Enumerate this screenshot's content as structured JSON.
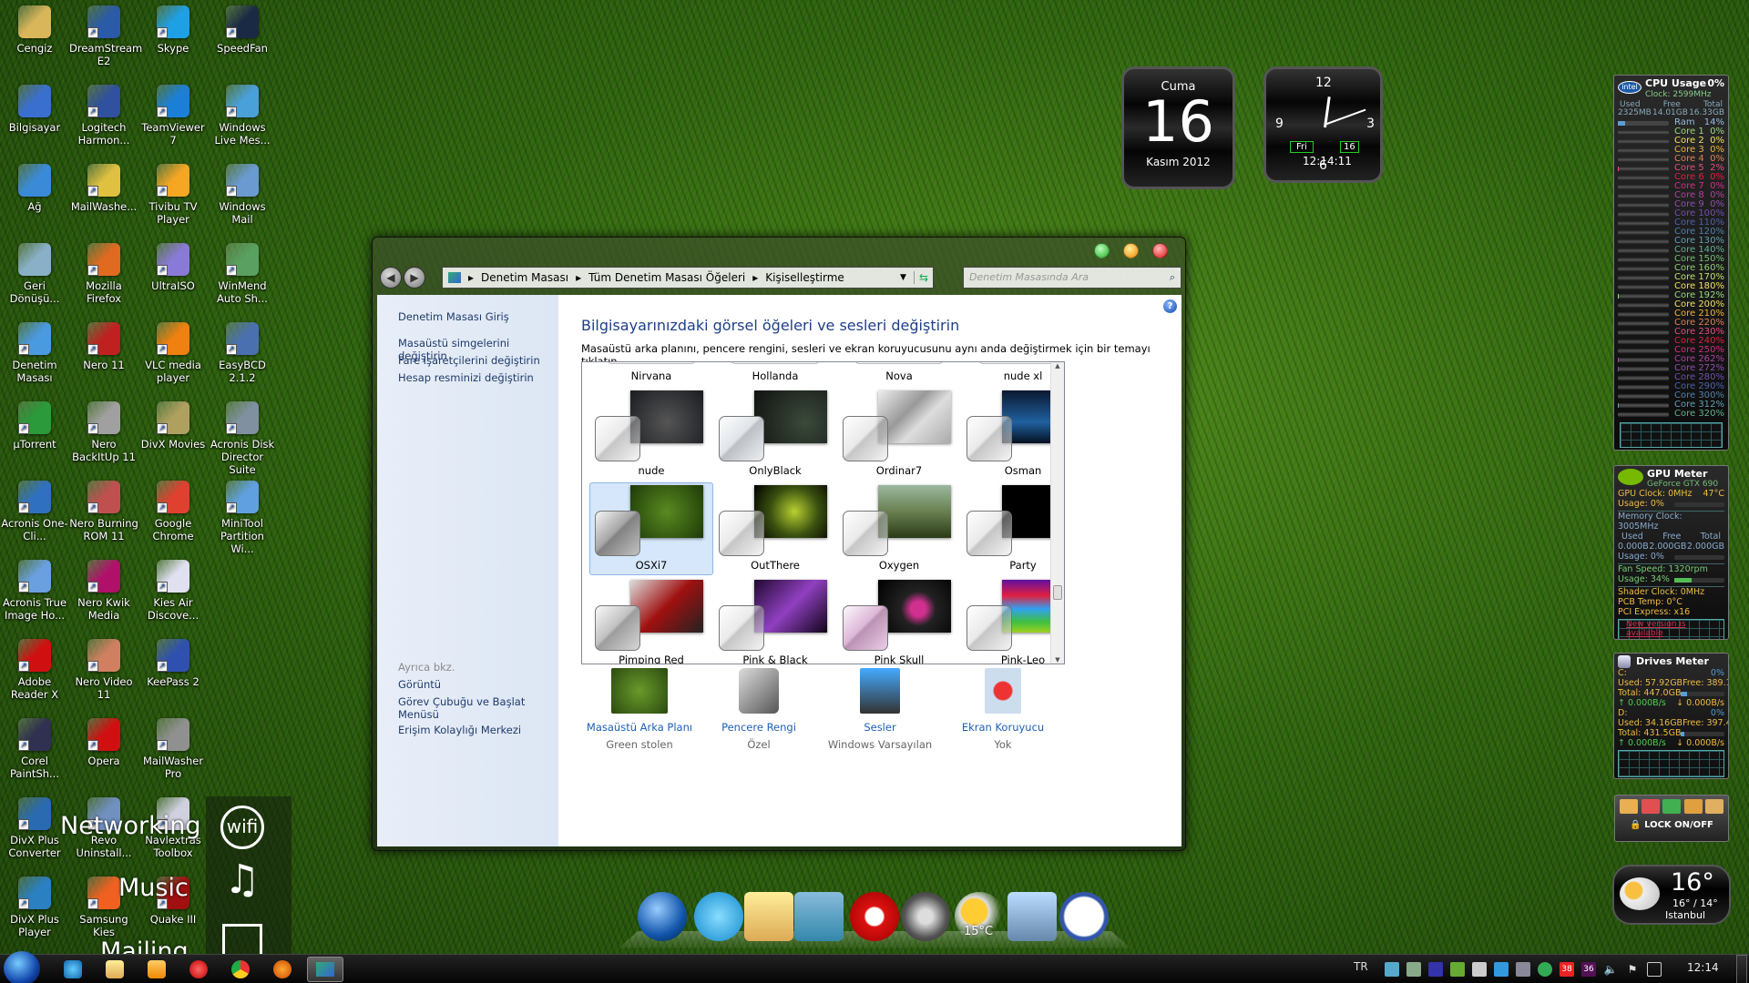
{
  "desktop_icons": [
    [
      "Cengiz",
      "DreamStream E2",
      "Skype",
      "SpeedFan"
    ],
    [
      "Bilgisayar",
      "Logitech Harmon...",
      "TeamViewer 7",
      "Windows Live Mes..."
    ],
    [
      "Ağ",
      "MailWashe...",
      "Tivibu TV Player",
      "Windows Mail"
    ],
    [
      "Geri Dönüşü...",
      "Mozilla Firefox",
      "UltraISO",
      "WinMend Auto Sh..."
    ],
    [
      "Denetim Masası",
      "Nero 11",
      "VLC media player",
      "EasyBCD 2.1.2"
    ],
    [
      "µTorrent",
      "Nero BackItUp 11",
      "DivX Movies",
      "Acronis Disk Director Suite"
    ],
    [
      "Acronis One-Cli...",
      "Nero Burning ROM 11",
      "Google Chrome",
      "MiniTool Partition Wi..."
    ],
    [
      "Acronis True Image Ho...",
      "Nero Kwik Media",
      "Kies Air Discove..."
    ],
    [
      "Adobe Reader X",
      "Nero Video 11",
      "KeePass 2"
    ],
    [
      "Corel PaintSh...",
      "Opera",
      "MailWasher Pro"
    ],
    [
      "DivX Plus Converter",
      "Revo Uninstall...",
      "Navlextras Toolbox"
    ],
    [
      "DivX Plus Player",
      "Samsung Kies",
      "Quake III"
    ]
  ],
  "desktop_icon_colors": [
    [
      "#d9b65a",
      "#2a5aa8",
      "#1ea0e6",
      "#1a2a44"
    ],
    [
      "#3a6fd0",
      "#3050a0",
      "#1b7fd8",
      "#4aa0d8"
    ],
    [
      "#3a8ad8",
      "#e0c040",
      "#f5a623",
      "#6a9ad0"
    ],
    [
      "#8ab0c8",
      "#e06a20",
      "#8a7ad8",
      "#5aa060"
    ],
    [
      "#4a9ae0",
      "#c02020",
      "#f08010",
      "#4a70b0"
    ],
    [
      "#2a9a3a",
      "#a0a0a0",
      "#b0a060",
      "#8090a0"
    ],
    [
      "#3070c0",
      "#c05050",
      "#e04030",
      "#60a0e0"
    ],
    [
      "#6aa0e0",
      "#b0106a",
      "#e0e0f0"
    ],
    [
      "#d01010",
      "#d08060",
      "#3050b0"
    ],
    [
      "#303050",
      "#d01010",
      "#909090"
    ],
    [
      "#2a6ab0",
      "#7090c0",
      "#d0d0e0"
    ],
    [
      "#2a80c0",
      "#f06020",
      "#a01010"
    ]
  ],
  "tiles": {
    "networking": "Networking",
    "wifi": "wifi",
    "music": "Music",
    "mailing": "Mailing"
  },
  "calendar": {
    "day_name": "Cuma",
    "day": "16",
    "month_year": "Kasım 2012"
  },
  "clock": {
    "n12": "12",
    "n3": "3",
    "n6": "6",
    "n9": "9",
    "weekday": "Fri",
    "date": "16",
    "time": "12:14:11"
  },
  "cpu": {
    "title": "CPU Usage",
    "total": "0%",
    "clock": "Clock: 2599MHz",
    "headers": [
      "Used",
      "Free",
      "Total"
    ],
    "mem": [
      "2325MB",
      "14.01GB",
      "16.33GB"
    ],
    "ram_label": "Ram",
    "ram_pct": 14,
    "ram": "14%",
    "cores": [
      0,
      0,
      0,
      0,
      2,
      0,
      0,
      0,
      0,
      0,
      0,
      0,
      0,
      0,
      0,
      0,
      0,
      0,
      2,
      0,
      0,
      0,
      0,
      0,
      0,
      2,
      2,
      0,
      0,
      0,
      2,
      0
    ],
    "core_prefix": "Core ",
    "core_colors": [
      "#9ad97a",
      "#f0e060",
      "#f0b040",
      "#e08050",
      "#e05080",
      "#e02040",
      "#d03080",
      "#b040a0",
      "#9050b0",
      "#7050b0",
      "#5060b0",
      "#5080b0",
      "#60a0b0",
      "#60b090",
      "#70c070",
      "#90d070",
      "#c0e070",
      "#f0e060"
    ]
  },
  "gpu": {
    "title": "GPU Meter",
    "model": "GeForce GTX 690",
    "gpu_clock": "GPU Clock: 0MHz",
    "temp": "47°C",
    "usage": "Usage: 0%",
    "mem_clock": "Memory Clock: 3005MHz",
    "headers": [
      "Used",
      "Free",
      "Total"
    ],
    "mem": [
      "0.000B",
      "2.000GB",
      "2.000GB"
    ],
    "mem_usage": "Usage: 0%",
    "fan": "Fan Speed: 1320rpm",
    "fan_usage": "Usage: 34%",
    "fan_pct": 34,
    "shader": "Shader Clock: 0MHz",
    "pcb": "PCB Temp: 0°C",
    "pci": "PCI Express: x16",
    "notice": "New version is available"
  },
  "drives": {
    "title": "Drives Meter",
    "list": [
      {
        "name": "C:",
        "pct": "0%",
        "used": "Used: 57.92GB",
        "free": "Free: 389.1GB",
        "total": "Total: 447.0GB",
        "up": "0.000B/s",
        "down": "0.000B/s",
        "fill": 13
      },
      {
        "name": "D:",
        "pct": "0%",
        "used": "Used: 34.16GB",
        "free": "Free: 397.4GB",
        "total": "Total: 431.5GB",
        "up": "0.000B/s",
        "down": "0.000B/s",
        "fill": 8
      }
    ]
  },
  "lock": {
    "label": "LOCK ON/OFF"
  },
  "weather": {
    "temp": "16°",
    "range": "16° / 14°",
    "city": "Istanbul"
  },
  "window": {
    "breadcrumb": [
      "Denetim Masası",
      "Tüm Denetim Masası Öğeleri",
      "Kişiselleştirme"
    ],
    "search_placeholder": "Denetim Masasında Ara",
    "left_links": [
      "Denetim Masası Giriş",
      "Masaüstü simgelerini değiştirin",
      "Fare işaretçilerini değiştirin",
      "Hesap resminizi değiştirin"
    ],
    "see_also": "Ayrıca bkz.",
    "see_also_links": [
      "Görüntü",
      "Görev Çubuğu ve Başlat Menüsü",
      "Erişim Kolaylığı Merkezi"
    ],
    "title": "Bilgisayarınızdaki görsel öğeleri ve sesleri değiştirin",
    "description": "Masaüstü arka planını, pencere rengini, sesleri ve ekran koruyucusunu aynı anda değiştirmek için bir temayı tıklatın.",
    "top_labels": [
      "Nirvana",
      "Hollanda",
      "Nova",
      "nude xl"
    ],
    "themes": [
      {
        "name": "nude",
        "wp": "radial-gradient(circle at 50% 60%,#555,#1a1c20)",
        "sw": ""
      },
      {
        "name": "OnlyBlack",
        "wp": "radial-gradient(circle at 70% 60%,#3a4a3a,#111)",
        "sw": "#e6f0fa"
      },
      {
        "name": "Ordinar7",
        "wp": "linear-gradient(135deg,#eee,#999 40%,#ddd 60%,#aaa)",
        "sw": ""
      },
      {
        "name": "Osman",
        "wp": "linear-gradient(#0a1830,#2060a0 60%,#051020)",
        "sw": ""
      },
      {
        "name": "OSXi7",
        "wp": "radial-gradient(circle,#5a8a20,#1d3a08)",
        "sw": "#555",
        "selected": true
      },
      {
        "name": "OutThere",
        "wp": "radial-gradient(circle at 55% 50%,#b8d030,#3a5010 50%,#000)",
        "sw": ""
      },
      {
        "name": "Oxygen",
        "wp": "linear-gradient(#9ab8a0,#6a8050 50%,#2a3a18)",
        "sw": ""
      },
      {
        "name": "Party",
        "wp": "#000",
        "sw": ""
      },
      {
        "name": "Pimping Red",
        "wp": "linear-gradient(135deg,#ddd,#a01010 50%,#222)",
        "sw": "#999"
      },
      {
        "name": "Pink & Black",
        "wp": "linear-gradient(135deg,#200830,#9040c0 50%,#100418)",
        "sw": ""
      },
      {
        "name": "Pink Skull",
        "wp": "radial-gradient(circle at 55% 55%,#d03090 15%,#222 35%,#000)",
        "sw": "#e080d0"
      },
      {
        "name": "Pink-Leo",
        "wp": "linear-gradient(#6010a0,#e02040 30%,#30a0f0 55%,#40c040 80%,#a0d020)",
        "sw": ""
      }
    ],
    "bottom": [
      {
        "label": "Masaüstü Arka Planı",
        "sub": "Green stolen"
      },
      {
        "label": "Pencere Rengi",
        "sub": "Özel"
      },
      {
        "label": "Sesler",
        "sub": "Windows Varsayılan"
      },
      {
        "label": "Ekran Koruyucu",
        "sub": "Yok"
      }
    ]
  },
  "dock": {
    "weather_temp": "15°C",
    "icons": [
      "windows-orb-icon",
      "internet-explorer-icon",
      "folder-icon",
      "media-player-icon",
      "opera-icon",
      "settings-wheel-icon",
      "weather-icon",
      "recycle-bin-icon",
      "clock-icon"
    ]
  },
  "taskbar": {
    "language": "TR",
    "time": "12:14",
    "tray_badge1": "38",
    "tray_badge2": "36"
  }
}
